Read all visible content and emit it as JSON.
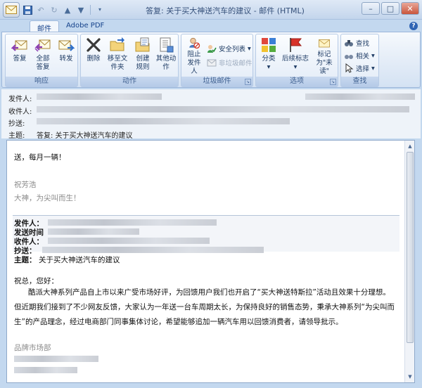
{
  "window": {
    "title": "答复: 关于买大神送汽车的建议 - 邮件 (HTML)"
  },
  "tabs": [
    {
      "label": "邮件"
    },
    {
      "label": "Adobe PDF"
    }
  ],
  "ribbon": {
    "respond": {
      "label": "响应",
      "reply": "答复",
      "reply_all": "全部答复",
      "forward": "转发"
    },
    "actions": {
      "label": "动作",
      "delete": "删除",
      "move_to": "移至文件夹",
      "create_rule": "创建规则",
      "other_actions": "其他动作"
    },
    "junk": {
      "label": "垃圾邮件",
      "block_sender": "阻止发件人",
      "safe_lists": "安全列表",
      "not_junk": "非垃圾邮件"
    },
    "options": {
      "label": "选项",
      "categorize": "分类",
      "follow_up": "后续标志",
      "mark_unread": "标记为\"未读\""
    },
    "find": {
      "label": "查找",
      "find": "查找",
      "related": "相关",
      "select": "选择"
    }
  },
  "headers": {
    "from_label": "发件人:",
    "to_label": "收件人:",
    "cc_label": "抄送:",
    "subject_label": "主题:",
    "subject_value": "答复: 关于买大神送汽车的建议"
  },
  "body": {
    "reply_text": "送，每月一辆！",
    "sign_name": "祝芳浩",
    "sign_slogan": "大神，为尖叫而生！",
    "fwd_from_label": "发件人：",
    "fwd_sent_label": "发送时间",
    "fwd_to_label": "收件人：",
    "fwd_cc_label": "抄送：",
    "fwd_subject_label": "主题：",
    "fwd_subject_value": "关于买大神送汽车的建议",
    "greeting": "祝总，您好：",
    "paragraph": "酷派大神系列产品自上市以来广受市场好评，为回馈用户我们也开启了“买大神送特斯拉”活动且效果十分理想。但近期我们接到了不少网友反馈，大家认为一年送一台车周期太长，为保持良好的销售态势，秉承大神系列“为尖叫而生”的产品理念，经过电商部门同事集体讨论，希望能够追加一辆汽车用以回馈消费者，请领导批示。",
    "department": "品牌市场部"
  }
}
